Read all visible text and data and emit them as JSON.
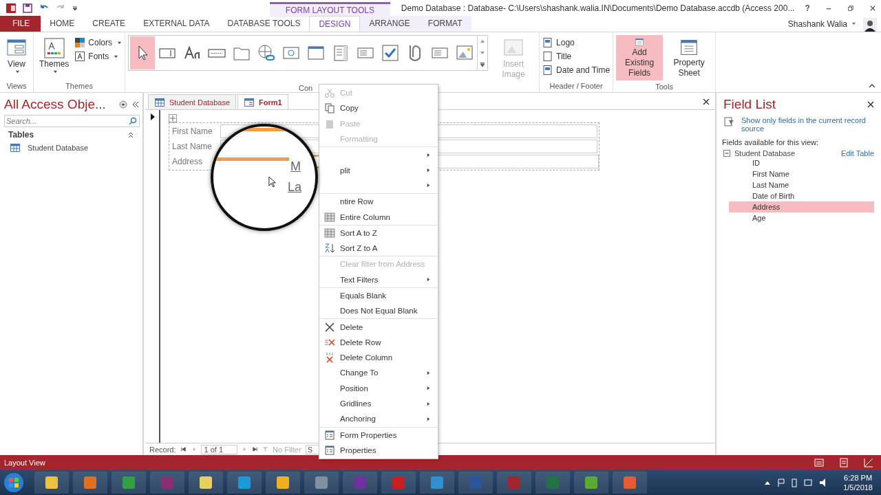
{
  "window": {
    "title": "Demo Database : Database- C:\\Users\\shashank.walia.IN\\Documents\\Demo Database.accdb (Access 200...",
    "contextual_header": "FORM LAYOUT TOOLS",
    "user": "Shashank Walia",
    "help": "?"
  },
  "tabs": [
    {
      "label": "FILE",
      "kind": "file",
      "selected": false
    },
    {
      "label": "HOME",
      "kind": "normal",
      "selected": false
    },
    {
      "label": "CREATE",
      "kind": "normal",
      "selected": false
    },
    {
      "label": "EXTERNAL DATA",
      "kind": "normal",
      "selected": false
    },
    {
      "label": "DATABASE TOOLS",
      "kind": "normal",
      "selected": false
    },
    {
      "label": "DESIGN",
      "kind": "contextual",
      "selected": true
    },
    {
      "label": "ARRANGE",
      "kind": "contextual",
      "selected": false
    },
    {
      "label": "FORMAT",
      "kind": "contextual",
      "selected": false
    }
  ],
  "ribbon": {
    "views": {
      "button": "View",
      "group": "Views"
    },
    "themes": {
      "button": "Themes",
      "colors": "Colors",
      "fonts": "Fonts",
      "group": "Themes"
    },
    "controls": {
      "group": "Con",
      "items": [
        {
          "kind": "pointer",
          "selected": true
        },
        {
          "kind": "textbox",
          "selected": false
        },
        {
          "kind": "label",
          "selected": false
        },
        {
          "kind": "button",
          "selected": false
        },
        {
          "kind": "tab",
          "selected": false
        },
        {
          "kind": "hyperlink",
          "selected": false
        },
        {
          "kind": "browser",
          "selected": false
        },
        {
          "kind": "navigation",
          "selected": false
        },
        {
          "kind": "combo",
          "selected": false
        },
        {
          "kind": "list",
          "selected": false
        },
        {
          "kind": "check",
          "selected": false
        },
        {
          "kind": "attachment",
          "selected": false
        },
        {
          "kind": "list",
          "selected": false
        },
        {
          "kind": "image",
          "selected": false
        }
      ]
    },
    "insert_image": {
      "label": "Insert Image",
      "disabled": true
    },
    "header_footer": {
      "items": [
        "Logo",
        "Title",
        "Date and Time"
      ],
      "group": "Header / Footer"
    },
    "tools": {
      "items": [
        {
          "label": "Add Existing Fields",
          "selected": true
        },
        {
          "label": "Property Sheet",
          "selected": false
        }
      ],
      "group": "Tools"
    }
  },
  "nav_pane": {
    "title": "All Access Obje...",
    "search": {
      "placeholder": "Search..."
    },
    "section": "Tables",
    "items": [
      "Student Database"
    ]
  },
  "documents": {
    "tabs": [
      {
        "label": "Student Database",
        "kind": "table",
        "selected": false
      },
      {
        "label": "Form1",
        "kind": "form",
        "selected": true
      }
    ],
    "form_fields": [
      {
        "label": "First Name",
        "selected": false
      },
      {
        "label": "Last Name",
        "selected": false
      },
      {
        "label": "Address",
        "selected": true
      }
    ],
    "record_nav": {
      "label": "Record:",
      "position": "1 of 1",
      "filter": "No Filter",
      "search": "S"
    }
  },
  "context_menu": [
    {
      "label": "Cut",
      "kind": "cut",
      "disabled": true,
      "submenu": false,
      "separator_after": false
    },
    {
      "label": "Copy",
      "kind": "copy",
      "disabled": false,
      "submenu": false,
      "separator_after": false
    },
    {
      "label": "Paste",
      "kind": "paste",
      "disabled": true,
      "submenu": false,
      "separator_after": false
    },
    {
      "label": "Formatting",
      "kind": "plain",
      "disabled": true,
      "submenu": false,
      "separator_after": true
    },
    {
      "kind": "plain",
      "disabled": false,
      "submenu": true,
      "separator_after": false
    },
    {
      "label": "plit",
      "kind": "plain",
      "disabled": false,
      "submenu": true,
      "separator_after": false
    },
    {
      "kind": "plain",
      "disabled": false,
      "submenu": true,
      "separator_after": true
    },
    {
      "label": "ntire Row",
      "kind": "plain",
      "disabled": false,
      "submenu": false,
      "separator_after": false
    },
    {
      "label": "Entire Column",
      "kind": "grid",
      "disabled": false,
      "submenu": false,
      "separator_after": true
    },
    {
      "label": "Sort A to Z",
      "kind": "grid",
      "disabled": false,
      "submenu": false,
      "separator_after": false
    },
    {
      "label": "Sort Z to A",
      "kind": "sortza",
      "disabled": false,
      "submenu": false,
      "separator_after": true
    },
    {
      "label": "Clear filter from Address",
      "kind": "plain",
      "disabled": true,
      "submenu": false,
      "separator_after": false
    },
    {
      "label": "Text Filters",
      "kind": "plain",
      "disabled": false,
      "submenu": true,
      "separator_after": true
    },
    {
      "label": "Equals Blank",
      "kind": "plain",
      "disabled": false,
      "submenu": false,
      "separator_after": false
    },
    {
      "label": "Does Not Equal Blank",
      "kind": "plain",
      "disabled": false,
      "submenu": false,
      "separator_after": true
    },
    {
      "label": "Delete",
      "kind": "delete",
      "disabled": false,
      "submenu": false,
      "separator_after": false
    },
    {
      "label": "Delete Row",
      "kind": "deleterow",
      "disabled": false,
      "submenu": false,
      "separator_after": false
    },
    {
      "label": "Delete Column",
      "kind": "deletecol",
      "disabled": false,
      "submenu": false,
      "separator_after": false
    },
    {
      "label": "Change To",
      "kind": "plain",
      "disabled": false,
      "submenu": true,
      "separator_after": false
    },
    {
      "label": "Position",
      "kind": "plain",
      "disabled": false,
      "submenu": true,
      "separator_after": false
    },
    {
      "label": "Gridlines",
      "kind": "plain",
      "disabled": false,
      "submenu": true,
      "separator_after": false
    },
    {
      "label": "Anchoring",
      "kind": "plain",
      "disabled": false,
      "submenu": true,
      "separator_after": true
    },
    {
      "label": "Form Properties",
      "kind": "props",
      "disabled": false,
      "submenu": false,
      "separator_after": false
    },
    {
      "label": "Properties",
      "kind": "props",
      "disabled": false,
      "submenu": false,
      "separator_after": false
    }
  ],
  "magnifier": {
    "texts": [
      "M",
      "La"
    ]
  },
  "field_list": {
    "title": "Field List",
    "filter_link": "Show only fields in the current record source",
    "available_label": "Fields available for this view:",
    "table": "Student Database",
    "edit_link": "Edit Table",
    "fields": [
      {
        "label": "ID",
        "selected": false
      },
      {
        "label": "First Name",
        "selected": false
      },
      {
        "label": "Last Name",
        "selected": false
      },
      {
        "label": "Date of Birth",
        "selected": false
      },
      {
        "label": "Address",
        "selected": true
      },
      {
        "label": "Age",
        "selected": false
      }
    ]
  },
  "status_bar": {
    "text": "Layout View"
  },
  "taskbar": {
    "apps": [
      {
        "color": "#f0c040"
      },
      {
        "color": "#e07020"
      },
      {
        "color": "#30a040"
      },
      {
        "color": "#8a3070"
      },
      {
        "color": "#e8d060"
      },
      {
        "color": "#1a9ad6"
      },
      {
        "color": "#f0b020"
      },
      {
        "color": "#8090a0"
      },
      {
        "color": "#7030a0"
      },
      {
        "color": "#c8201c"
      },
      {
        "color": "#3090d0"
      },
      {
        "color": "#2b579a"
      },
      {
        "color": "#a4262c"
      },
      {
        "color": "#217346"
      },
      {
        "color": "#5aac30"
      },
      {
        "color": "#e85a30"
      }
    ],
    "time": "6:28 PM",
    "date": "1/5/2018"
  }
}
